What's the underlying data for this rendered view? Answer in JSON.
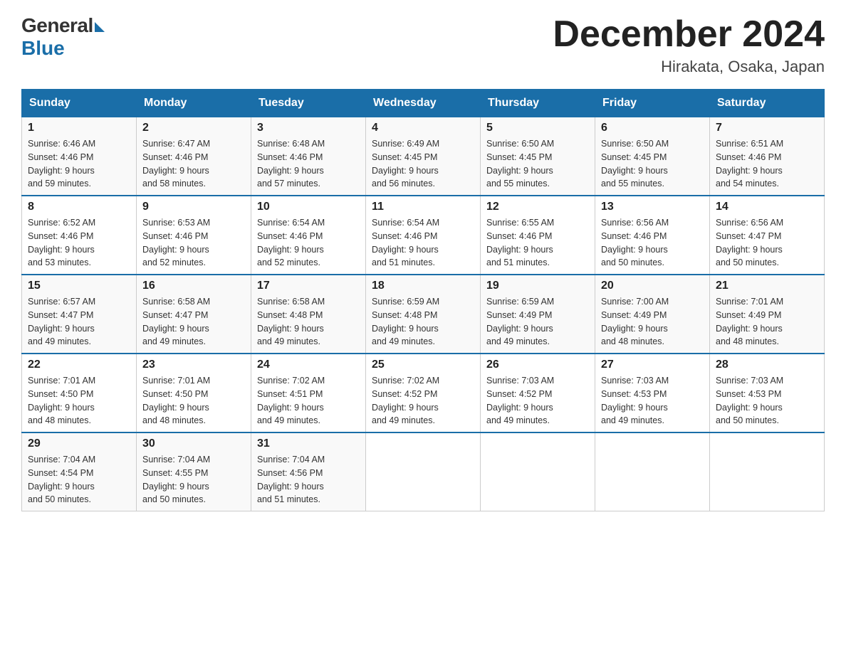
{
  "header": {
    "logo_general": "General",
    "logo_blue": "Blue",
    "month_title": "December 2024",
    "location": "Hirakata, Osaka, Japan"
  },
  "days_of_week": [
    "Sunday",
    "Monday",
    "Tuesday",
    "Wednesday",
    "Thursday",
    "Friday",
    "Saturday"
  ],
  "weeks": [
    [
      {
        "date": "1",
        "sunrise": "6:46 AM",
        "sunset": "4:46 PM",
        "daylight": "9 hours and 59 minutes."
      },
      {
        "date": "2",
        "sunrise": "6:47 AM",
        "sunset": "4:46 PM",
        "daylight": "9 hours and 58 minutes."
      },
      {
        "date": "3",
        "sunrise": "6:48 AM",
        "sunset": "4:46 PM",
        "daylight": "9 hours and 57 minutes."
      },
      {
        "date": "4",
        "sunrise": "6:49 AM",
        "sunset": "4:45 PM",
        "daylight": "9 hours and 56 minutes."
      },
      {
        "date": "5",
        "sunrise": "6:50 AM",
        "sunset": "4:45 PM",
        "daylight": "9 hours and 55 minutes."
      },
      {
        "date": "6",
        "sunrise": "6:50 AM",
        "sunset": "4:45 PM",
        "daylight": "9 hours and 55 minutes."
      },
      {
        "date": "7",
        "sunrise": "6:51 AM",
        "sunset": "4:46 PM",
        "daylight": "9 hours and 54 minutes."
      }
    ],
    [
      {
        "date": "8",
        "sunrise": "6:52 AM",
        "sunset": "4:46 PM",
        "daylight": "9 hours and 53 minutes."
      },
      {
        "date": "9",
        "sunrise": "6:53 AM",
        "sunset": "4:46 PM",
        "daylight": "9 hours and 52 minutes."
      },
      {
        "date": "10",
        "sunrise": "6:54 AM",
        "sunset": "4:46 PM",
        "daylight": "9 hours and 52 minutes."
      },
      {
        "date": "11",
        "sunrise": "6:54 AM",
        "sunset": "4:46 PM",
        "daylight": "9 hours and 51 minutes."
      },
      {
        "date": "12",
        "sunrise": "6:55 AM",
        "sunset": "4:46 PM",
        "daylight": "9 hours and 51 minutes."
      },
      {
        "date": "13",
        "sunrise": "6:56 AM",
        "sunset": "4:46 PM",
        "daylight": "9 hours and 50 minutes."
      },
      {
        "date": "14",
        "sunrise": "6:56 AM",
        "sunset": "4:47 PM",
        "daylight": "9 hours and 50 minutes."
      }
    ],
    [
      {
        "date": "15",
        "sunrise": "6:57 AM",
        "sunset": "4:47 PM",
        "daylight": "9 hours and 49 minutes."
      },
      {
        "date": "16",
        "sunrise": "6:58 AM",
        "sunset": "4:47 PM",
        "daylight": "9 hours and 49 minutes."
      },
      {
        "date": "17",
        "sunrise": "6:58 AM",
        "sunset": "4:48 PM",
        "daylight": "9 hours and 49 minutes."
      },
      {
        "date": "18",
        "sunrise": "6:59 AM",
        "sunset": "4:48 PM",
        "daylight": "9 hours and 49 minutes."
      },
      {
        "date": "19",
        "sunrise": "6:59 AM",
        "sunset": "4:49 PM",
        "daylight": "9 hours and 49 minutes."
      },
      {
        "date": "20",
        "sunrise": "7:00 AM",
        "sunset": "4:49 PM",
        "daylight": "9 hours and 48 minutes."
      },
      {
        "date": "21",
        "sunrise": "7:01 AM",
        "sunset": "4:49 PM",
        "daylight": "9 hours and 48 minutes."
      }
    ],
    [
      {
        "date": "22",
        "sunrise": "7:01 AM",
        "sunset": "4:50 PM",
        "daylight": "9 hours and 48 minutes."
      },
      {
        "date": "23",
        "sunrise": "7:01 AM",
        "sunset": "4:50 PM",
        "daylight": "9 hours and 48 minutes."
      },
      {
        "date": "24",
        "sunrise": "7:02 AM",
        "sunset": "4:51 PM",
        "daylight": "9 hours and 49 minutes."
      },
      {
        "date": "25",
        "sunrise": "7:02 AM",
        "sunset": "4:52 PM",
        "daylight": "9 hours and 49 minutes."
      },
      {
        "date": "26",
        "sunrise": "7:03 AM",
        "sunset": "4:52 PM",
        "daylight": "9 hours and 49 minutes."
      },
      {
        "date": "27",
        "sunrise": "7:03 AM",
        "sunset": "4:53 PM",
        "daylight": "9 hours and 49 minutes."
      },
      {
        "date": "28",
        "sunrise": "7:03 AM",
        "sunset": "4:53 PM",
        "daylight": "9 hours and 50 minutes."
      }
    ],
    [
      {
        "date": "29",
        "sunrise": "7:04 AM",
        "sunset": "4:54 PM",
        "daylight": "9 hours and 50 minutes."
      },
      {
        "date": "30",
        "sunrise": "7:04 AM",
        "sunset": "4:55 PM",
        "daylight": "9 hours and 50 minutes."
      },
      {
        "date": "31",
        "sunrise": "7:04 AM",
        "sunset": "4:56 PM",
        "daylight": "9 hours and 51 minutes."
      },
      null,
      null,
      null,
      null
    ]
  ],
  "labels": {
    "sunrise": "Sunrise:",
    "sunset": "Sunset:",
    "daylight": "Daylight:"
  }
}
